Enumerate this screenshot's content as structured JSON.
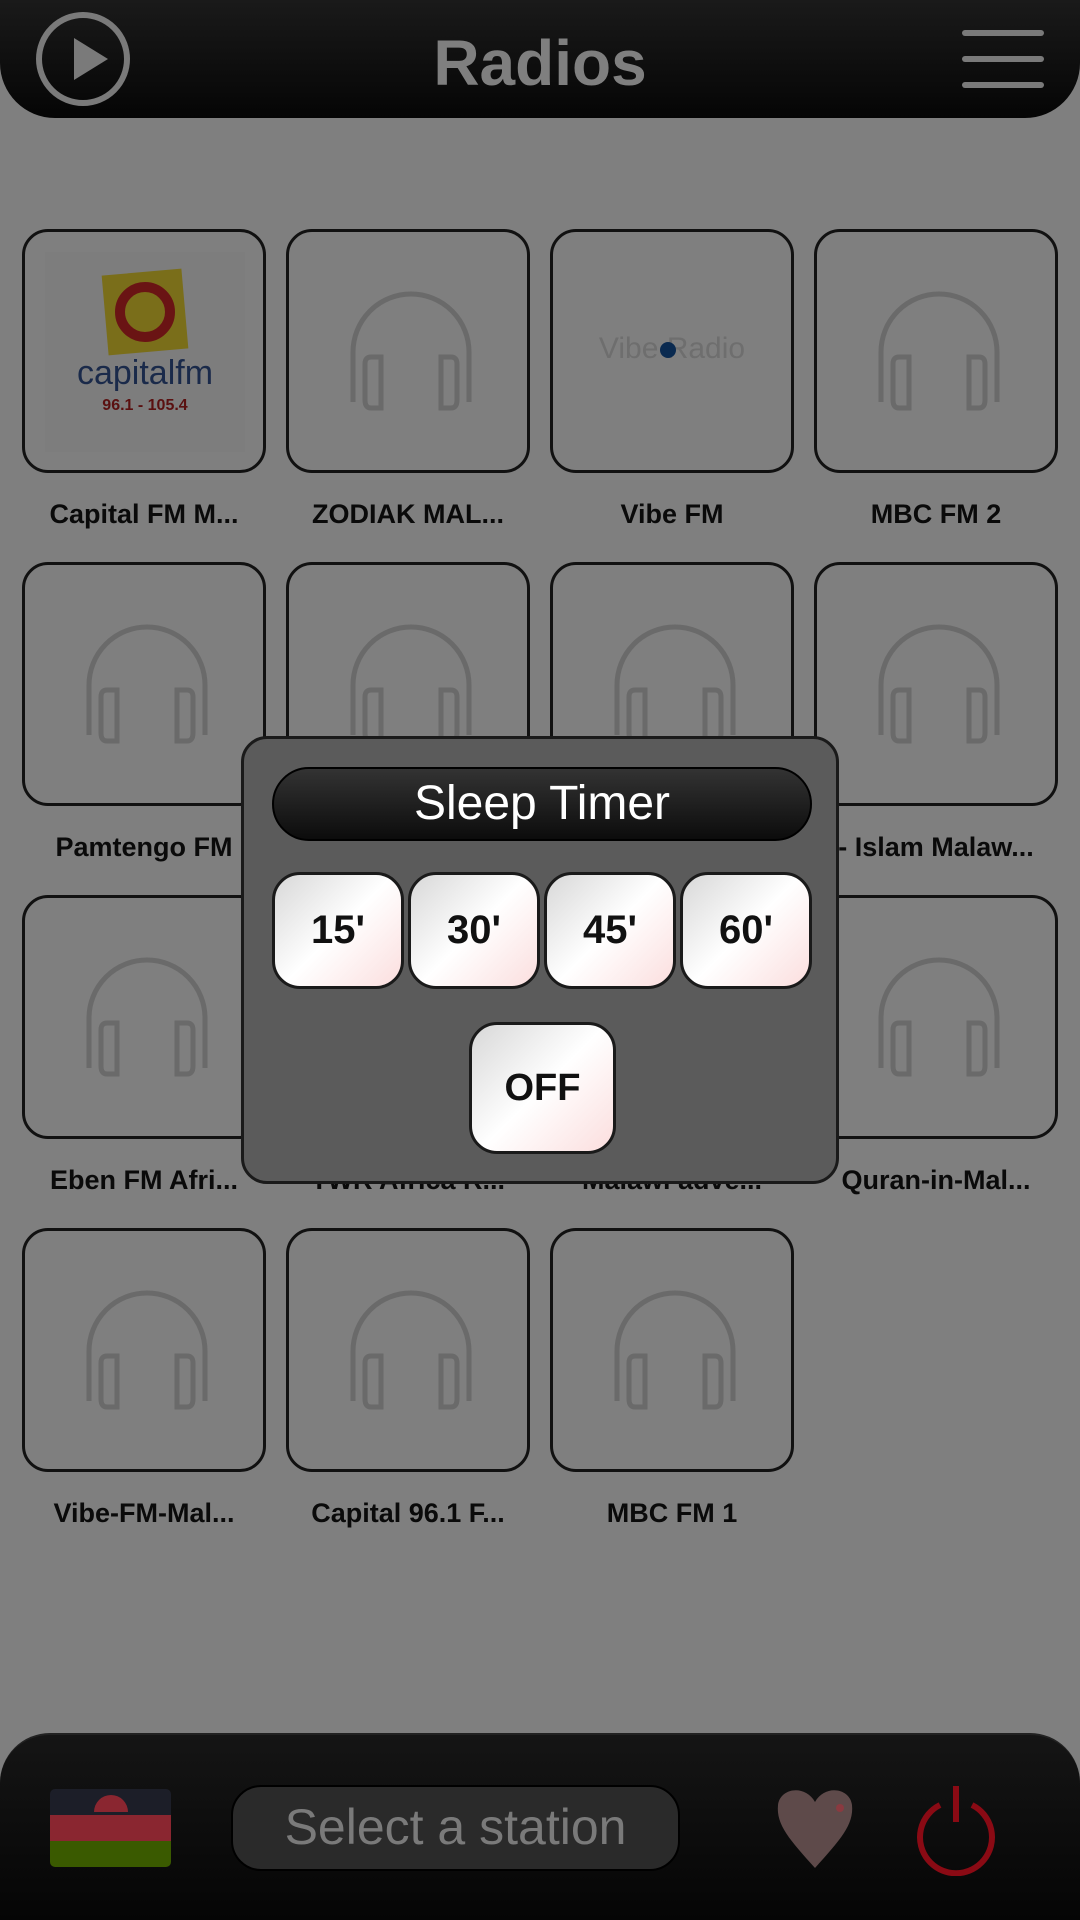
{
  "header": {
    "title": "Radios",
    "play_icon": "play-circle-icon",
    "menu_icon": "hamburger-menu-icon"
  },
  "stations": [
    {
      "name": "Capital FM M...",
      "logo": "capitalfm",
      "logo_text": "capitalfm",
      "logo_freq": "96.1 - 105.4"
    },
    {
      "name": "ZODIAK MAL...",
      "logo": "headphones-icon"
    },
    {
      "name": "Vibe FM",
      "logo": "vibe-radio",
      "logo_text": "Vibe Radio"
    },
    {
      "name": "MBC FM 2",
      "logo": "headphones-icon"
    },
    {
      "name": "Pamtengo  FM",
      "logo": "headphones-icon"
    },
    {
      "name": "",
      "logo": "headphones-icon"
    },
    {
      "name": "",
      "logo": "headphones-icon"
    },
    {
      "name": "- Islam Malaw...",
      "logo": "headphones-icon"
    },
    {
      "name": "Eben FM Afri...",
      "logo": "headphones-icon"
    },
    {
      "name": "TWR Africa R...",
      "logo": "headphones-icon"
    },
    {
      "name": "Malawi adve...",
      "logo": "headphones-icon"
    },
    {
      "name": "Quran-in-Mal...",
      "logo": "headphones-icon"
    },
    {
      "name": "Vibe-FM-Mal...",
      "logo": "headphones-icon"
    },
    {
      "name": "Capital 96.1 F...",
      "logo": "headphones-icon"
    },
    {
      "name": "MBC FM 1",
      "logo": "headphones-icon"
    }
  ],
  "sleep_timer": {
    "title": "Sleep Timer",
    "options": [
      "15'",
      "30'",
      "45'",
      "60'"
    ],
    "off_label": "OFF"
  },
  "footer": {
    "flag": "malawi-flag",
    "status": "Select a station",
    "favorite_icon": "heart-icon",
    "power_icon": "power-icon",
    "colors": {
      "flag_black": "#1c1e28",
      "flag_red": "#8a2630",
      "flag_green": "#3a5a00",
      "power": "#8a0a14"
    }
  }
}
